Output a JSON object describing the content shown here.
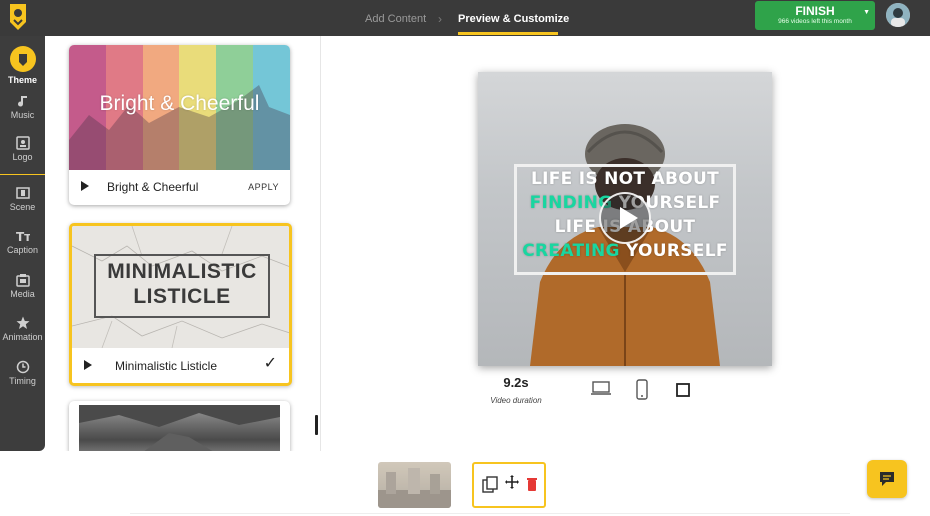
{
  "topbar": {
    "steps": [
      {
        "label": "Add Content",
        "active": false
      },
      {
        "label": "Preview & Customize",
        "active": true
      }
    ],
    "finish": {
      "label": "FINISH",
      "sub": "966 videos left this month"
    },
    "accent": "#f7c41f"
  },
  "sidenav": {
    "items": [
      {
        "label": "Theme",
        "icon": "theme-icon",
        "active": true
      },
      {
        "label": "Music",
        "icon": "music-note-icon"
      },
      {
        "label": "Logo",
        "icon": "logo-icon"
      },
      {
        "label": "Scene",
        "icon": "scene-icon"
      },
      {
        "label": "Caption",
        "icon": "caption-icon"
      },
      {
        "label": "Media",
        "icon": "media-icon"
      },
      {
        "label": "Animation",
        "icon": "star-icon"
      },
      {
        "label": "Timing",
        "icon": "timer-icon"
      }
    ]
  },
  "themes": [
    {
      "name": "Bright & Cheerful",
      "thumb_title": "Bright & Cheerful",
      "action": "APPLY",
      "selected": false
    },
    {
      "name": "Minimalistic Listicle",
      "thumb_title_1": "MINIMALISTIC",
      "thumb_title_2": "LISTICLE",
      "selected": true
    },
    {
      "name": "",
      "selected": false
    }
  ],
  "preview": {
    "quote": [
      {
        "parts": [
          {
            "text": "LIFE IS NOT ABOUT",
            "hl": false
          }
        ]
      },
      {
        "parts": [
          {
            "text": "FINDING ",
            "hl": true
          },
          {
            "text": "YOURSELF",
            "hl": false
          }
        ]
      },
      {
        "parts": [
          {
            "text": "LIFE IS ABOUT",
            "hl": false
          }
        ]
      },
      {
        "parts": [
          {
            "text": "CREATING ",
            "hl": true
          },
          {
            "text": "YOURSELF",
            "hl": false
          }
        ]
      }
    ],
    "highlight_color": "#19d6a0",
    "duration": "9.2s",
    "duration_label": "Video duration"
  }
}
